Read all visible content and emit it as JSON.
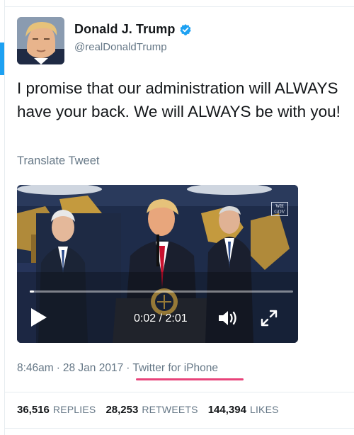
{
  "user": {
    "display_name": "Donald J. Trump",
    "handle": "@realDonaldTrump",
    "verified": true,
    "avatar_icon": "profile-photo"
  },
  "tweet": {
    "text": "I promise that our administration will ALWAYS have your back. We will ALWAYS be with you!",
    "translate_label": "Translate Tweet"
  },
  "video": {
    "current_time": "0:02",
    "duration": "2:01",
    "time_display": "0:02 / 2:01",
    "progress": 0.017,
    "badge_text": "WH GOV",
    "play_icon": "play-icon",
    "volume_icon": "volume-icon",
    "fullscreen_icon": "fullscreen-icon"
  },
  "meta": {
    "time": "8:46am",
    "date": "28 Jan 2017",
    "separator": "·",
    "source": "Twitter for iPhone"
  },
  "stats": {
    "replies_count": "36,516",
    "replies_label": "REPLIES",
    "retweets_count": "28,253",
    "retweets_label": "RETWEETS",
    "likes_count": "144,394",
    "likes_label": "LIKES"
  },
  "colors": {
    "brand_blue": "#1da1f2",
    "secondary_text": "#657786",
    "highlight_underline": "#e8437a"
  }
}
